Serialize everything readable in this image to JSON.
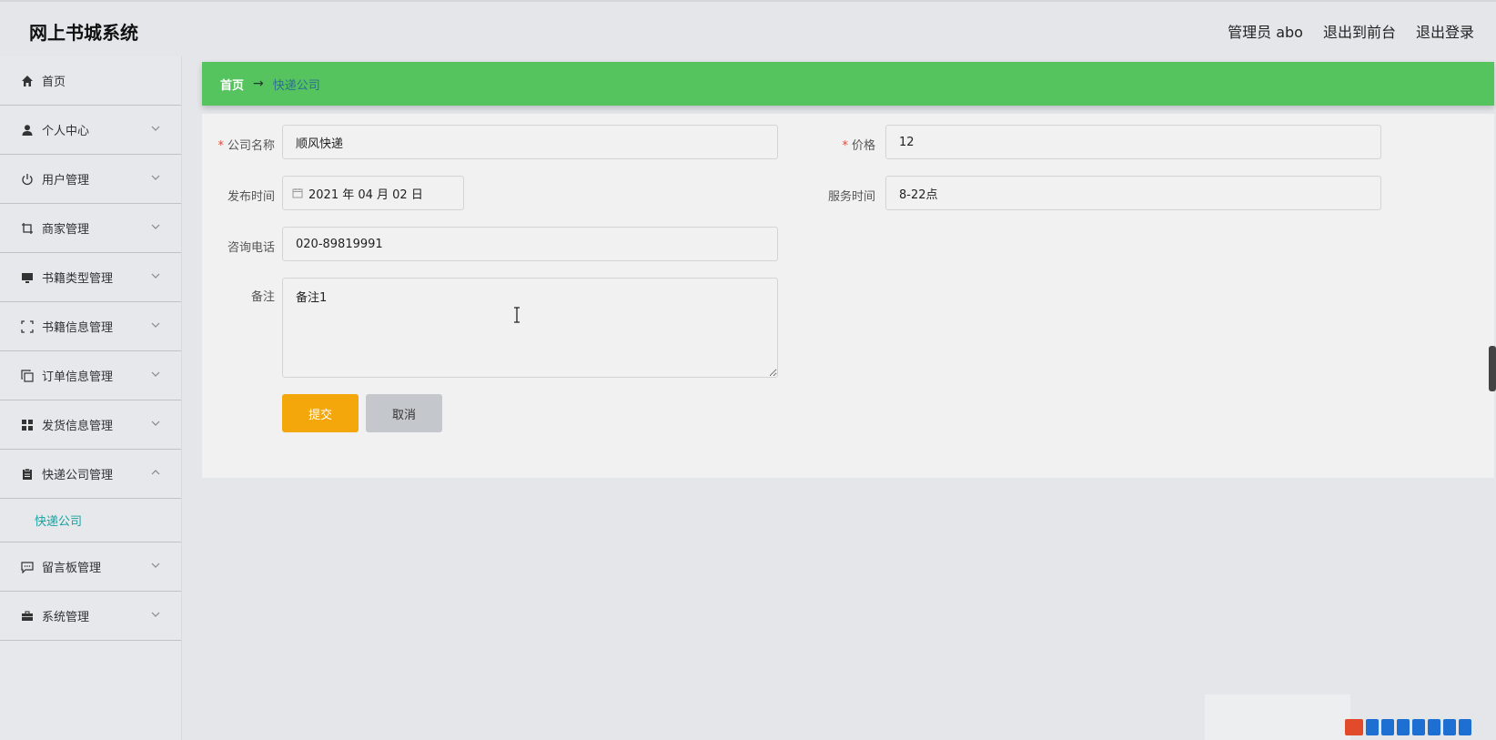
{
  "app": {
    "title": "网上书城系统"
  },
  "header": {
    "links": [
      {
        "label": "管理员 abo"
      },
      {
        "label": "退出到前台"
      },
      {
        "label": "退出登录"
      }
    ]
  },
  "sidebar": {
    "items": [
      {
        "label": "首页",
        "icon": "home-icon"
      },
      {
        "label": "个人中心",
        "icon": "user-icon"
      },
      {
        "label": "用户管理",
        "icon": "power-icon"
      },
      {
        "label": "商家管理",
        "icon": "crop-icon"
      },
      {
        "label": "书籍类型管理",
        "icon": "monitor-icon"
      },
      {
        "label": "书籍信息管理",
        "icon": "fullscreen-icon"
      },
      {
        "label": "订单信息管理",
        "icon": "copy-icon"
      },
      {
        "label": "发货信息管理",
        "icon": "grid-icon"
      },
      {
        "label": "快递公司管理",
        "icon": "clipboard-icon",
        "expanded": true
      },
      {
        "label": "留言板管理",
        "icon": "chat-icon"
      },
      {
        "label": "系统管理",
        "icon": "briefcase-icon"
      }
    ],
    "submenu": {
      "label": "快递公司"
    }
  },
  "breadcrumb": {
    "home": "首页",
    "separator": "→",
    "current": "快递公司"
  },
  "form": {
    "company_name": {
      "label": "公司名称",
      "required_mark": "*",
      "value": "顺风快递"
    },
    "price": {
      "label": "价格",
      "required_mark": "*",
      "value": "12"
    },
    "publish_time": {
      "label": "发布时间",
      "value": "2021 年 04 月 02 日"
    },
    "service_time": {
      "label": "服务时间",
      "value": "8-22点"
    },
    "phone": {
      "label": "咨询电话",
      "value": "020-89819991"
    },
    "remark": {
      "label": "备注",
      "value": "备注1"
    },
    "submit_label": "提交",
    "cancel_label": "取消"
  },
  "colors": {
    "breadcrumb_bg": "#55c45e",
    "submit_bg": "#f4a70b",
    "cancel_bg": "#c4c7cc",
    "active_submenu": "#17a2a0",
    "required": "#e04c3c"
  }
}
